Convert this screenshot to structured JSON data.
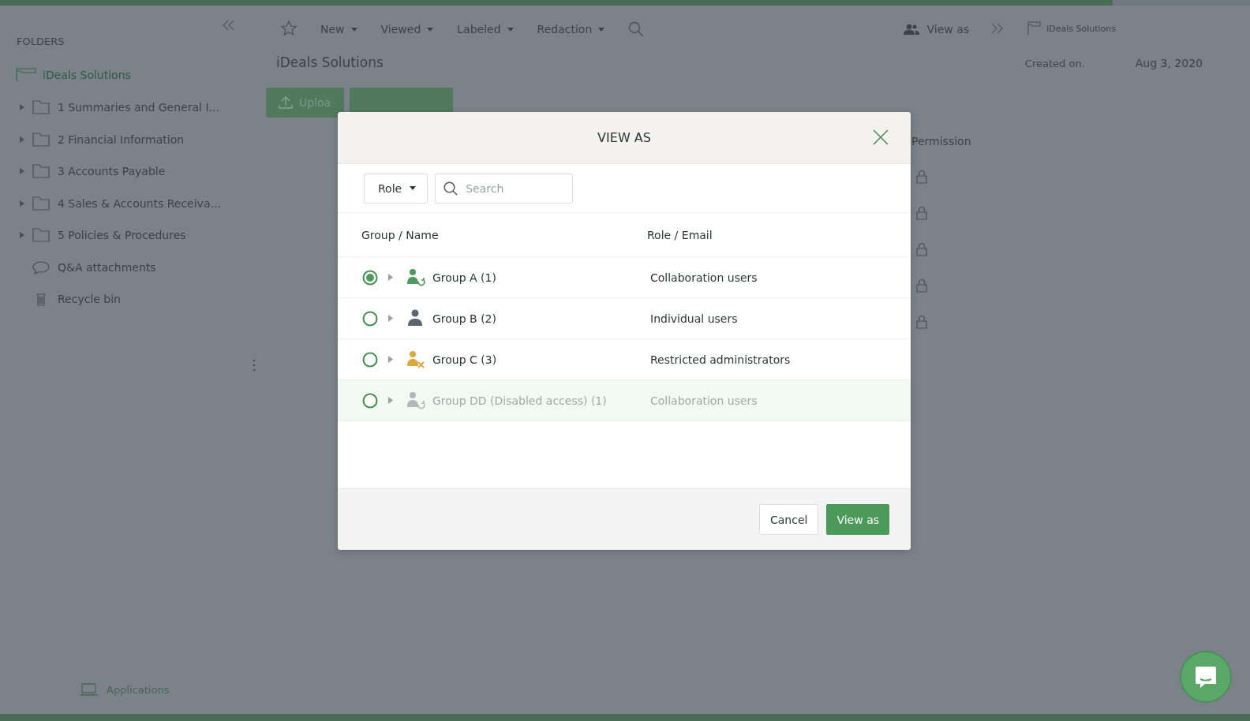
{
  "progress": {
    "level": 0.89
  },
  "sidebar": {
    "heading": "FOLDERS",
    "root": "iDeals Solutions",
    "items": [
      {
        "label": "1 Summaries and General I...",
        "kind": "folder"
      },
      {
        "label": "2 Financial Information",
        "kind": "folder"
      },
      {
        "label": "3 Accounts Payable",
        "kind": "folder"
      },
      {
        "label": "4 Sales & Accounts Receiva...",
        "kind": "folder"
      },
      {
        "label": "5 Policies & Procedures",
        "kind": "folder"
      },
      {
        "label": "Q&A attachments",
        "kind": "qa"
      },
      {
        "label": "Recycle bin",
        "kind": "recycle"
      }
    ],
    "footer": "Applications"
  },
  "toolbar": {
    "menus": [
      "New",
      "Viewed",
      "Labeled",
      "Redaction"
    ],
    "view_as": "View as",
    "breadcrumb": "iDeals Solutions"
  },
  "main": {
    "title": "iDeals Solutions",
    "created_label": "Created on.",
    "created_value": "Aug 3, 2020",
    "upload_button": "Uploa",
    "permission_header": "Permission"
  },
  "dialog": {
    "title": "VIEW AS",
    "role_filter": "Role",
    "search": {
      "placeholder": "Search"
    },
    "columns": [
      "Group / Name",
      "Role / Email"
    ],
    "rows": [
      {
        "name": "Group A (1)",
        "role": "Collaboration users",
        "kind": "collaboration",
        "selected": true,
        "disabled": false
      },
      {
        "name": "Group B (2)",
        "role": "Individual users",
        "kind": "individual",
        "selected": false,
        "disabled": false
      },
      {
        "name": "Group C (3)",
        "role": "Restricted administrators",
        "kind": "admin",
        "selected": false,
        "disabled": false
      },
      {
        "name": "Group DD (Disabled access) (1)",
        "role": "Collaboration users",
        "kind": "collaboration",
        "selected": false,
        "disabled": true
      }
    ],
    "buttons": [
      {
        "label": "Cancel",
        "kind": "secondary"
      },
      {
        "label": "View as",
        "kind": "primary"
      }
    ]
  }
}
